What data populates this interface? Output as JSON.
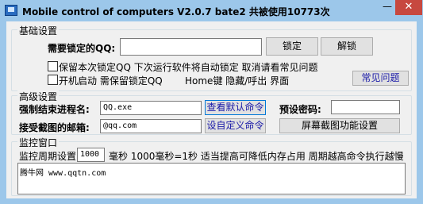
{
  "window": {
    "title": "Mobile control of computers  V2.0.7 bate2  共被使用10773次",
    "minimize_glyph": "—",
    "close_glyph": "✕",
    "brand_color": "#9cc7ea",
    "close_color": "#c7483f"
  },
  "basic": {
    "legend": "基础设置",
    "qq_label": "需要锁定的QQ:",
    "qq_value": "",
    "lock_button": "锁定",
    "unlock_button": "解锁",
    "opt_save_lock": "保留本次锁定QQ 下次运行软件将自动锁定 取消请看常见问题",
    "opt_startup": "开机启动 需保留锁定QQ",
    "home_hint": "Home键 隐藏/呼出 界面",
    "faq_button": "常见问题"
  },
  "advanced": {
    "legend": "高级设置",
    "kill_label": "强制结束进程名:",
    "kill_value": "QQ.exe",
    "default_cmd_button": "查看默认命令",
    "password_label": "预设密码:",
    "password_value": "",
    "email_label": "接受截图的邮箱:",
    "email_value": "@qq.com",
    "custom_cmd_button": "设自定义命令",
    "screenshot_button": "屏幕截图功能设置"
  },
  "monitor": {
    "legend": "监控窗口",
    "period_label": "监控周期设置",
    "period_value": "1000",
    "period_help": "毫秒  1000毫秒=1秒  适当提高可降低内存占用  周期越高命令执行越慢",
    "log_text": "腾牛网 www.qqtn.com"
  }
}
